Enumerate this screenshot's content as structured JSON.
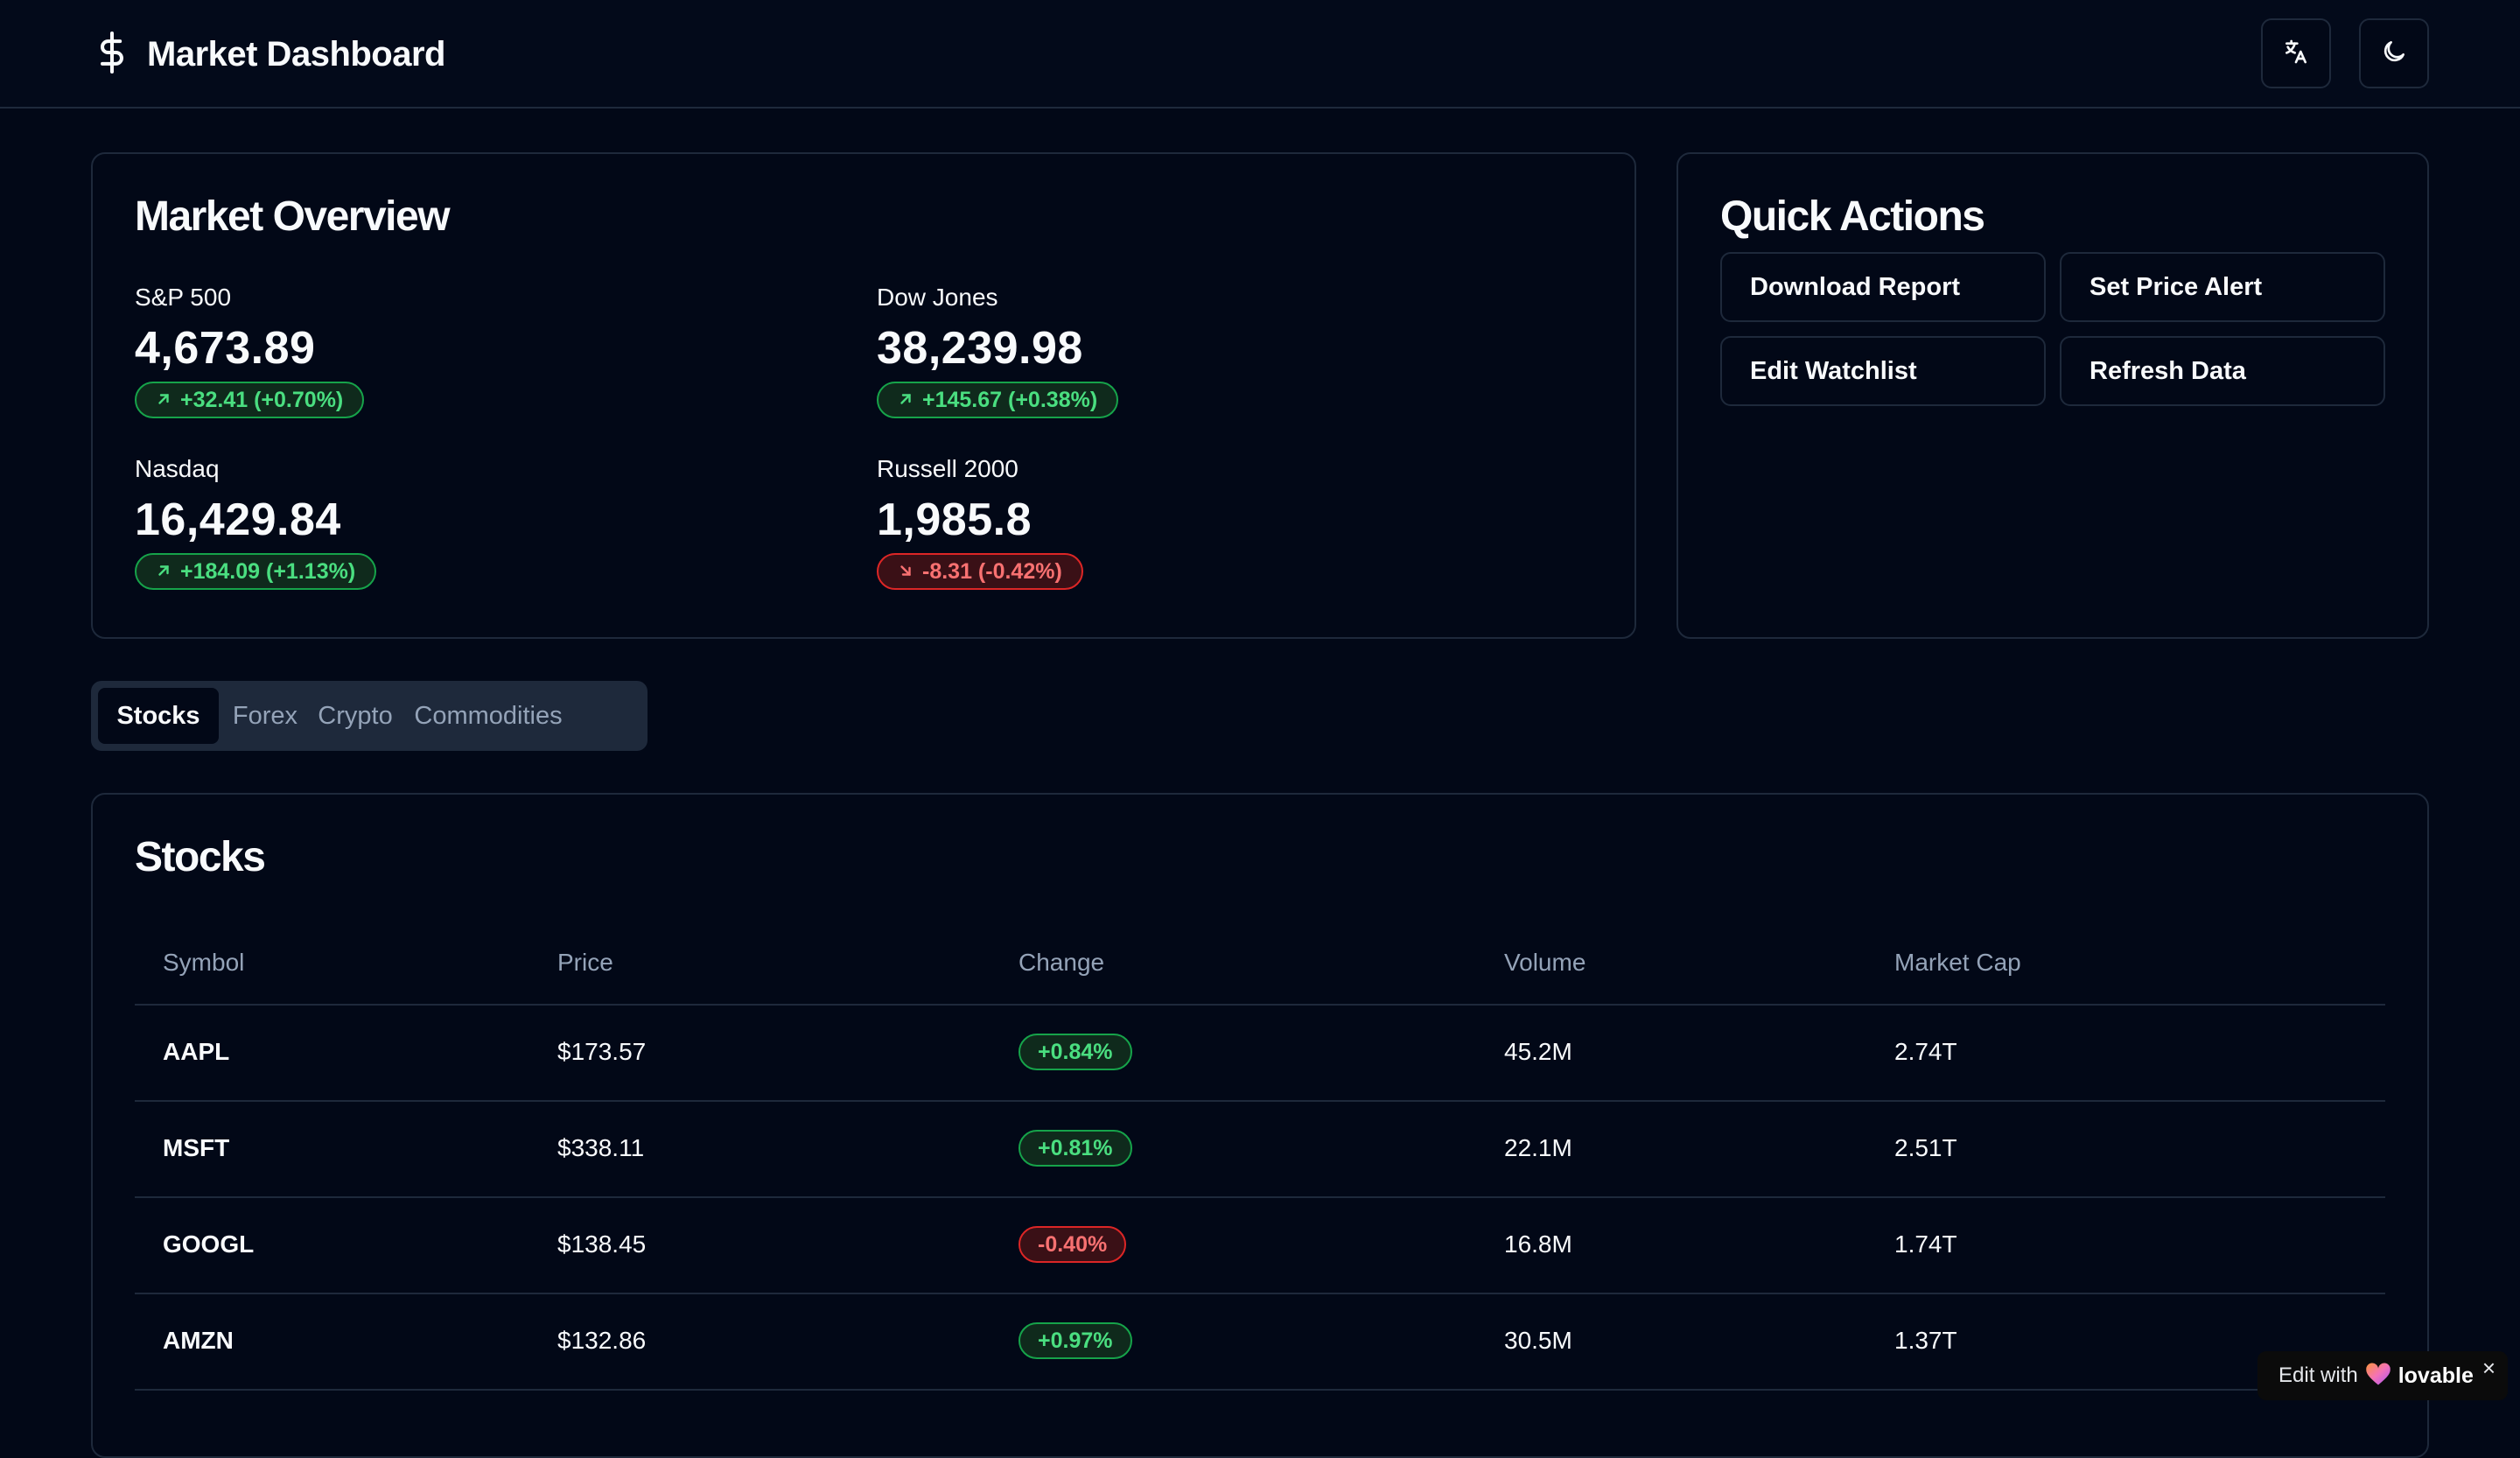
{
  "header": {
    "title": "Market Dashboard",
    "logo_icon": "dollar-sign-icon",
    "translate_icon": "languages-icon",
    "theme_icon": "moon-icon"
  },
  "overview": {
    "title": "Market Overview",
    "indices": [
      {
        "name": "S&P 500",
        "value": "4,673.89",
        "change": "+32.41 (+0.70%)",
        "direction": "up"
      },
      {
        "name": "Dow Jones",
        "value": "38,239.98",
        "change": "+145.67 (+0.38%)",
        "direction": "up"
      },
      {
        "name": "Nasdaq",
        "value": "16,429.84",
        "change": "+184.09 (+1.13%)",
        "direction": "up"
      },
      {
        "name": "Russell 2000",
        "value": "1,985.8",
        "change": "-8.31 (-0.42%)",
        "direction": "down"
      }
    ]
  },
  "quick_actions": {
    "title": "Quick Actions",
    "buttons": [
      "Download Report",
      "Set Price Alert",
      "Edit Watchlist",
      "Refresh Data"
    ]
  },
  "tabs": {
    "items": [
      "Stocks",
      "Forex",
      "Crypto",
      "Commodities"
    ],
    "active": "Stocks"
  },
  "stocks": {
    "title": "Stocks",
    "columns": [
      "Symbol",
      "Price",
      "Change",
      "Volume",
      "Market Cap"
    ],
    "rows": [
      {
        "symbol": "AAPL",
        "price": "$173.57",
        "change": "+0.84%",
        "direction": "up",
        "volume": "45.2M",
        "market_cap": "2.74T"
      },
      {
        "symbol": "MSFT",
        "price": "$338.11",
        "change": "+0.81%",
        "direction": "up",
        "volume": "22.1M",
        "market_cap": "2.51T"
      },
      {
        "symbol": "GOOGL",
        "price": "$138.45",
        "change": "-0.40%",
        "direction": "down",
        "volume": "16.8M",
        "market_cap": "1.74T"
      },
      {
        "symbol": "AMZN",
        "price": "$132.86",
        "change": "+0.97%",
        "direction": "up",
        "volume": "30.5M",
        "market_cap": "1.37T"
      }
    ]
  },
  "badge": {
    "prefix": "Edit with",
    "brand": "lovable",
    "close": "×"
  },
  "colors": {
    "background": "#020817",
    "border": "#1e293b",
    "positive": "#4ade80",
    "negative": "#f87171",
    "muted": "#94a3b8"
  }
}
